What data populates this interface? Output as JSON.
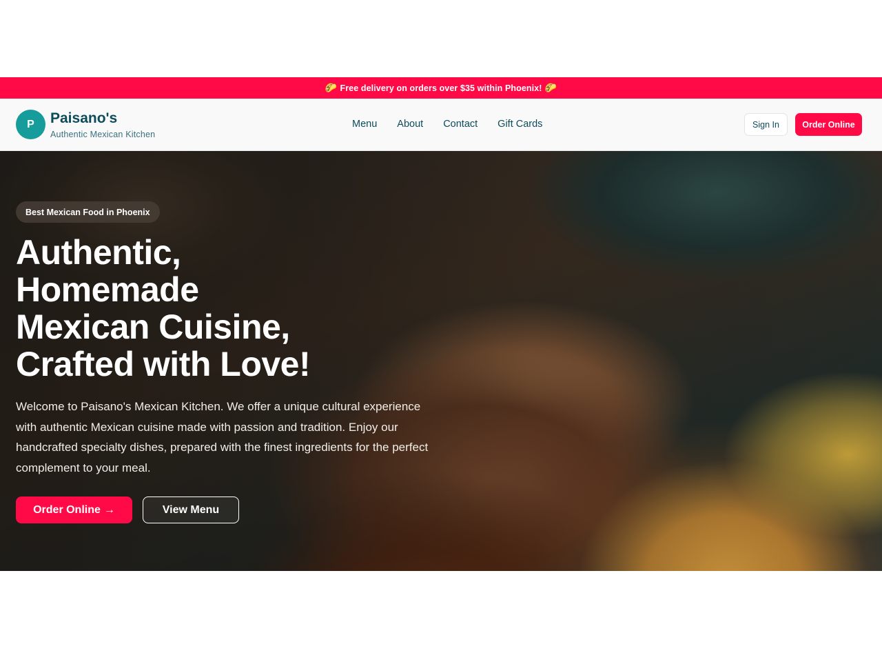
{
  "promo": {
    "text": "Free delivery on orders over $35 within Phoenix!",
    "icon_left": "🌮",
    "icon_right": "🌮"
  },
  "header": {
    "logo_letter": "P",
    "brand_name": "Paisano's",
    "brand_tagline": "Authentic Mexican Kitchen",
    "nav": [
      {
        "label": "Menu"
      },
      {
        "label": "About"
      },
      {
        "label": "Contact"
      },
      {
        "label": "Gift Cards"
      }
    ],
    "sign_in_label": "Sign In",
    "order_online_label": "Order Online"
  },
  "hero": {
    "badge": "Best Mexican Food in Phoenix",
    "title_lines": [
      "Authentic,",
      "Homemade",
      "Mexican Cuisine,",
      "Crafted with Love!"
    ],
    "description": "Welcome to Paisano's Mexican Kitchen. We offer a unique cultural experience with authentic Mexican cuisine made with passion and tradition. Enjoy our handcrafted specialty dishes, prepared with the finest ingredients for the perfect complement to your meal.",
    "order_button": "Order Online",
    "order_button_icon": "→",
    "menu_button": "View Menu"
  },
  "colors": {
    "accent": "#ff0a47",
    "brand_teal": "#169c9a",
    "brand_text": "#0e4b5a"
  }
}
